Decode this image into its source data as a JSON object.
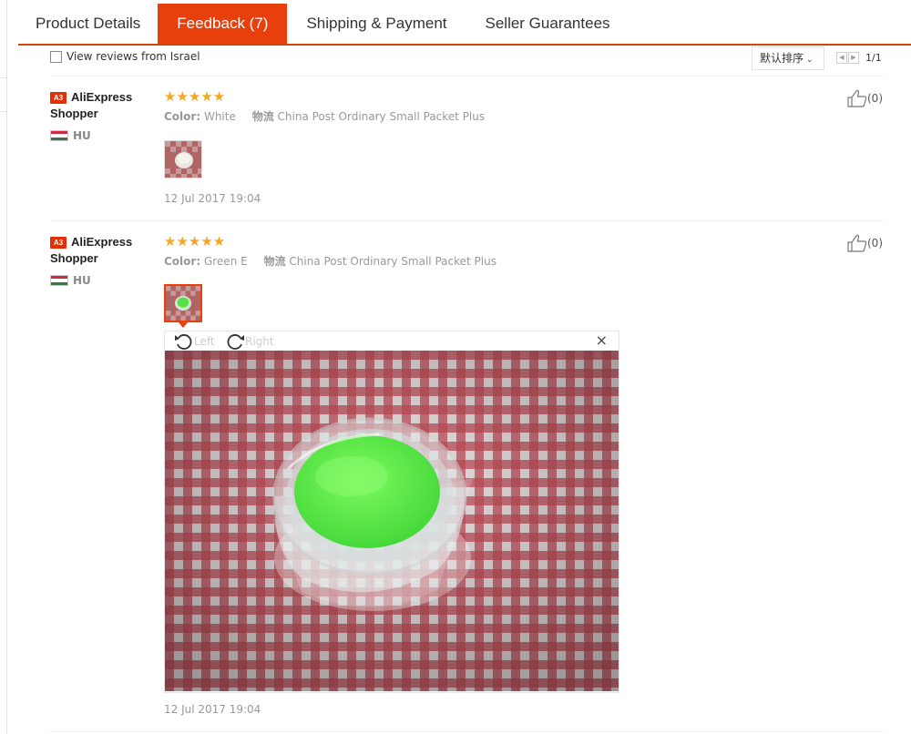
{
  "tabs": [
    {
      "label": "Product Details"
    },
    {
      "label": "Feedback (7)"
    },
    {
      "label": "Shipping & Payment"
    },
    {
      "label": "Seller Guarantees"
    }
  ],
  "filter": {
    "checkbox_label": "View reviews from Israel",
    "sort_label": "默认排序",
    "page": "1/1"
  },
  "reviews": [
    {
      "badge": "A3",
      "user": "AliExpress Shopper",
      "country": "HU",
      "rating": 5,
      "stars": "★★★★★",
      "color_label": "Color:",
      "color_value": "White",
      "ship_label": "物流",
      "ship_value": "China Post Ordinary Small Packet Plus",
      "date": "12 Jul 2017 19:04",
      "likes": "(0)"
    },
    {
      "badge": "A3",
      "user": "AliExpress Shopper",
      "country": "HU",
      "rating": 5,
      "stars": "★★★★★",
      "color_label": "Color:",
      "color_value": "Green E",
      "ship_label": "物流",
      "ship_value": "China Post Ordinary Small Packet Plus",
      "date": "12 Jul 2017 19:04",
      "likes": "(0)"
    }
  ],
  "viewer": {
    "rotate_left": "Left",
    "rotate_right": "Right",
    "close": "×"
  },
  "colors": {
    "accent": "#e8400c",
    "star": "#f5a623",
    "badge": "#e62e04"
  }
}
